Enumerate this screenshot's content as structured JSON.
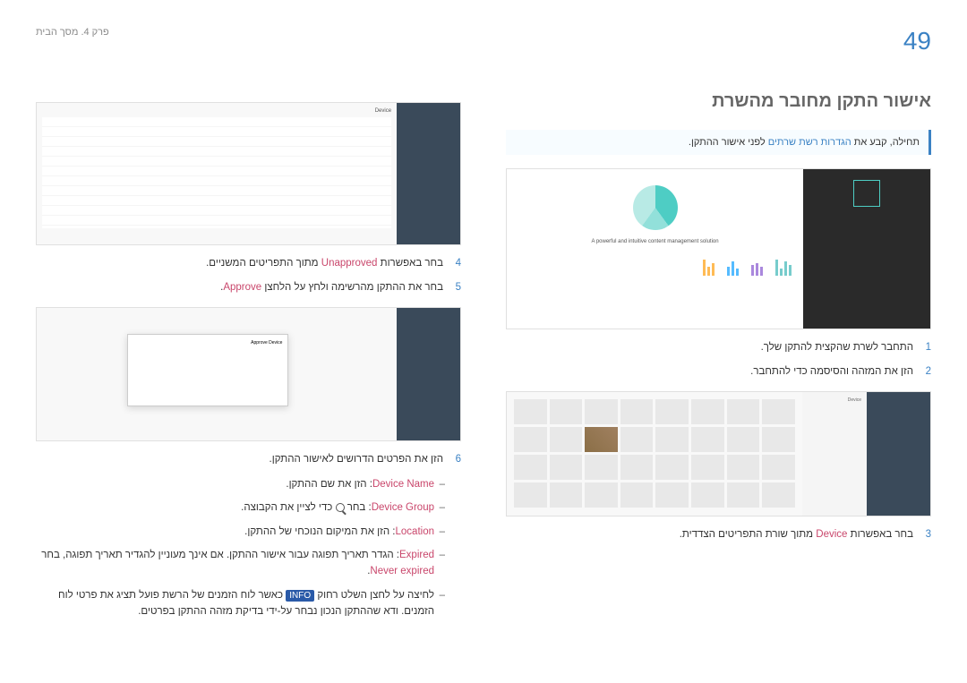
{
  "page_number": "49",
  "chapter": "פרק 4. מסך הבית",
  "title": "אישור התקן מחובר מהשרת",
  "tip": {
    "prefix": "תחילה, קבע את",
    "blue": " הגדרות רשת שרתים ",
    "suffix": "לפני אישור ההתקן."
  },
  "steps_right": {
    "s1_num": "1",
    "s1_text": "התחבר לשרת שהקצית להתקן שלך.",
    "s2_num": "2",
    "s2_text": "הזן את המזהה והסיסמה כדי להתחבר.",
    "s3_num": "3",
    "s3_prefix": "בחר באפשרות ",
    "s3_term": "Device",
    "s3_suffix": " מתוך שורת התפריטים הצדדית."
  },
  "steps_left": {
    "s4_num": "4",
    "s4_prefix": "בחר באפשרות ",
    "s4_term": "Unapproved",
    "s4_suffix": " מתוך התפריטים המשניים.",
    "s5_num": "5",
    "s5_text": "בחר את ההתקן מהרשימה ולחץ על הלחצן ",
    "s5_term": "Approve",
    "s5_dot": ".",
    "s6_num": "6",
    "s6_text": "הזן את הפרטים הדרושים לאישור ההתקן."
  },
  "subs": {
    "a_term": "Device Name",
    "a_text": ": הזן את שם ההתקן.",
    "b_term": "Device Group",
    "b_text_pre": ": בחר ",
    "b_text_post": " כדי לציין את הקבוצה.",
    "c_term": "Location",
    "c_text": ": הזן את המיקום הנוכחי של ההתקן.",
    "d_term": "Expired",
    "d_text": ": הגדר תאריך תפוגה עבור אישור ההתקן. אם אינך מעוניין להגדיר תאריך תפוגה, בחר ",
    "d_term2": "Never expired",
    "d_dot": ".",
    "e_text_pre": "לחיצה על לחצן השלט רחוק ",
    "e_badge": "INFO",
    "e_text_post": " כאשר לוח הזמנים של הרשת פועל תציג את פרטי לוח הזמנים. ודא שההתקן הנכון נבחר על-ידי בדיקת מזהה ההתקן בפרטים."
  },
  "sh1_label": "A powerful and intuitive content management solution"
}
